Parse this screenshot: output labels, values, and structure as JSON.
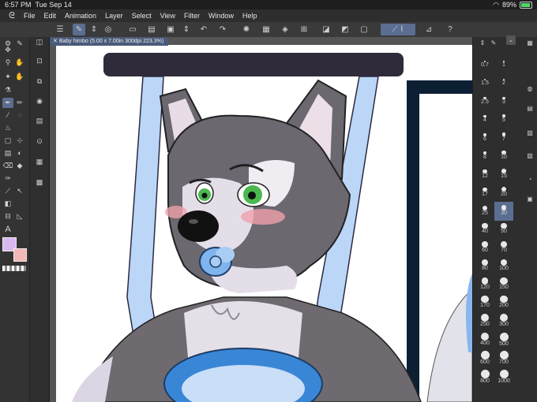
{
  "status": {
    "time": "6:57 PM",
    "date": "Tue Sep 14",
    "battery": "89%",
    "battery_level": 0.89
  },
  "menu": [
    "File",
    "Edit",
    "Animation",
    "Layer",
    "Select",
    "View",
    "Filter",
    "Window",
    "Help"
  ],
  "document_tab": {
    "title": "Baby himbo",
    "info": "(5.00 x 7.00in 300dpi 223.3%)"
  },
  "colors": {
    "main": "#d9b8f2",
    "sub": "#f4b6b6",
    "accent": "#5b6e91"
  },
  "brush_sizes": [
    {
      "a": "0.7",
      "b": "1"
    },
    {
      "a": "1.5",
      "b": "2"
    },
    {
      "a": "2.5",
      "b": "3"
    },
    {
      "a": "4",
      "b": "5"
    },
    {
      "a": "6",
      "b": "7"
    },
    {
      "a": "8",
      "b": "10"
    },
    {
      "a": "12",
      "b": "15"
    },
    {
      "a": "17",
      "b": "20"
    },
    {
      "a": "25",
      "b": "30"
    },
    {
      "a": "40",
      "b": "50"
    },
    {
      "a": "60",
      "b": "70"
    },
    {
      "a": "80",
      "b": "100"
    },
    {
      "a": "120",
      "b": "150"
    },
    {
      "a": "170",
      "b": "200"
    },
    {
      "a": "250",
      "b": "300"
    },
    {
      "a": "400",
      "b": "500"
    },
    {
      "a": "600",
      "b": "700"
    },
    {
      "a": "800",
      "b": "1000"
    }
  ],
  "selected_brush_size": "30"
}
